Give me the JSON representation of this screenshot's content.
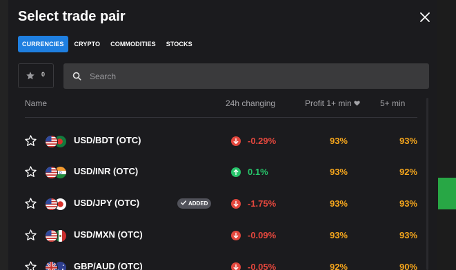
{
  "modal": {
    "title": "Select trade pair",
    "tabs": [
      {
        "label": "CURRENCIES",
        "active": true
      },
      {
        "label": "CRYPTO",
        "active": false
      },
      {
        "label": "COMMODITIES",
        "active": false
      },
      {
        "label": "STOCKS",
        "active": false
      }
    ],
    "favorites_count": "0",
    "search": {
      "placeholder": "Search",
      "value": ""
    },
    "columns": {
      "name": "Name",
      "change": "24h changing",
      "profit1": "Profit 1+ min",
      "profit5": "5+ min"
    }
  },
  "rows": [
    {
      "pair": "USD/BDT (OTC)",
      "change": "-0.29%",
      "direction": "down",
      "profit1": "93%",
      "profit5": "93%",
      "badge": ""
    },
    {
      "pair": "USD/INR (OTC)",
      "change": "0.1%",
      "direction": "up",
      "profit1": "93%",
      "profit5": "92%",
      "badge": ""
    },
    {
      "pair": "USD/JPY (OTC)",
      "change": "-1.75%",
      "direction": "down",
      "profit1": "93%",
      "profit5": "93%",
      "badge": "ADDED"
    },
    {
      "pair": "USD/MXN (OTC)",
      "change": "-0.09%",
      "direction": "down",
      "profit1": "93%",
      "profit5": "93%",
      "badge": ""
    },
    {
      "pair": "GBP/AUD (OTC)",
      "change": "-0.05%",
      "direction": "down",
      "profit1": "92%",
      "profit5": "90%",
      "badge": ""
    }
  ],
  "colors": {
    "accent": "#1f7fe0",
    "negative": "#e3473d",
    "positive": "#27c46a",
    "profit": "#f4a51c",
    "chart_candle": "#28a745"
  },
  "icons": {
    "close": "close-icon",
    "favorites": "star-icon",
    "search": "search-icon",
    "sort": "heart-icon",
    "change_down": "arrow-down-icon",
    "change_up": "arrow-up-icon",
    "added": "check-icon"
  }
}
